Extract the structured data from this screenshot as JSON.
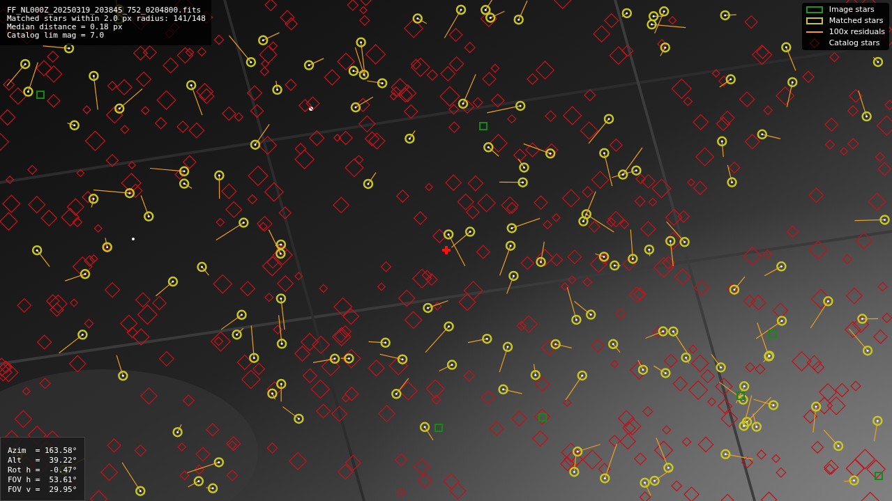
{
  "info": {
    "lines": [
      "FF_NL000Z_20250319_203845_752_0204800.fits",
      "Matched stars within 2.0 px radius: 141/148",
      "Median distance = 0.18 px",
      "Catalog lim mag = 7.0"
    ]
  },
  "legend": [
    {
      "label": "Image stars"
    },
    {
      "kind": "matched",
      "label": "Matched stars"
    },
    {
      "kind": "residual",
      "label": "100x residuals"
    },
    {
      "kind": "catalog",
      "label": "Catalog stars"
    }
  ],
  "pointing": {
    "lines": [
      "Azim  = 163.58°",
      "Alt   =  39.22°",
      "Rot h =  -0.47°",
      "FOV h =  53.61°",
      "FOV v =  29.95°"
    ]
  }
}
